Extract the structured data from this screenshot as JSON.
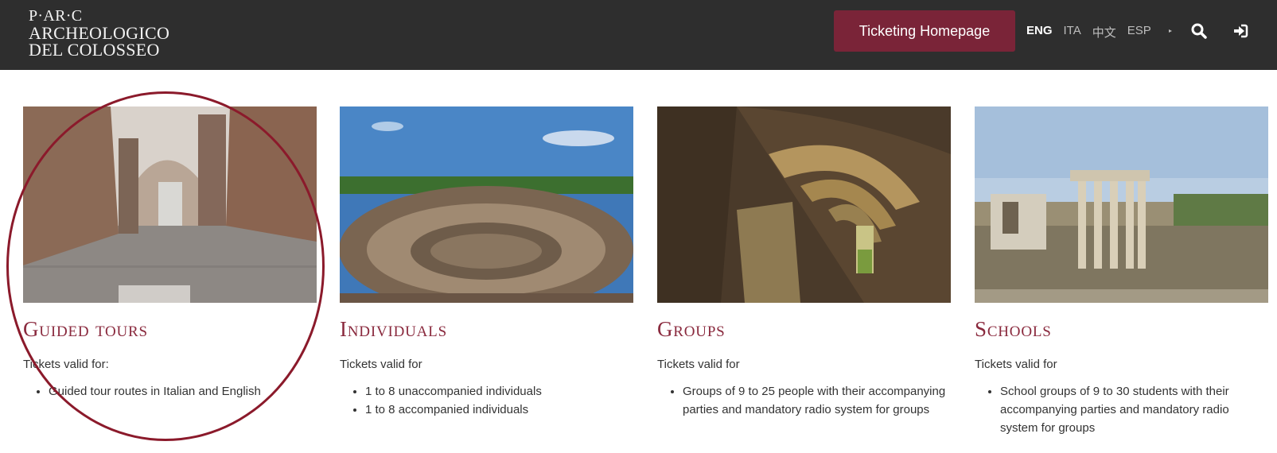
{
  "header": {
    "logo_lines": [
      "P·AR·C",
      "ARCHEOLOGICO",
      "DEL COLOSSEO"
    ],
    "cta_label": "Ticketing Homepage",
    "languages": [
      {
        "code": "ENG",
        "active": true
      },
      {
        "code": "ITA",
        "active": false
      },
      {
        "code": "中文",
        "active": false
      },
      {
        "code": "ESP",
        "active": false
      }
    ],
    "icons": [
      "search-icon",
      "login-icon"
    ]
  },
  "cards": [
    {
      "title": "Guided tours",
      "subtitle": "Tickets valid for:",
      "bullets": [
        "Guided tour routes in Italian and English"
      ]
    },
    {
      "title": "Individuals",
      "subtitle": "Tickets valid for",
      "bullets": [
        "1 to 8 unaccompanied individuals",
        "1 to 8 accompanied individuals"
      ]
    },
    {
      "title": "Groups",
      "subtitle": "Tickets valid for",
      "bullets": [
        "Groups of 9 to 25 people with their accompanying parties and mandatory radio system for groups"
      ]
    },
    {
      "title": "Schools",
      "subtitle": "Tickets valid for",
      "bullets": [
        "School groups of 9 to 30 students with their accompanying parties and mandatory radio system for groups"
      ]
    }
  ],
  "colors": {
    "header_bg": "#2e2e2e",
    "accent": "#7a2438",
    "title": "#8a2a3e",
    "annotation": "#8b1a2b"
  }
}
